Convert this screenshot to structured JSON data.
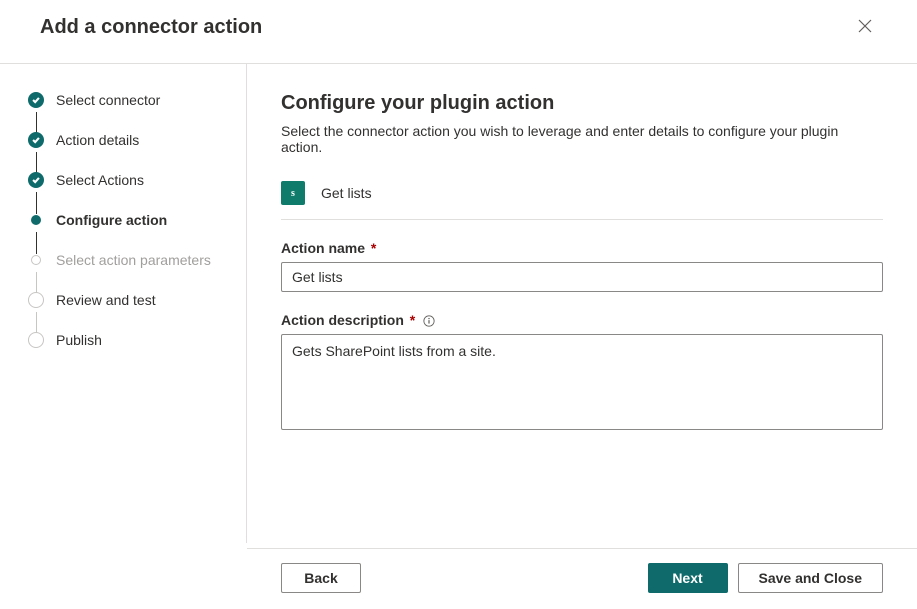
{
  "header": {
    "title": "Add a connector action"
  },
  "steps": [
    {
      "label": "Select connector",
      "state": "completed"
    },
    {
      "label": "Action details",
      "state": "completed"
    },
    {
      "label": "Select Actions",
      "state": "completed"
    },
    {
      "label": "Configure action",
      "state": "current"
    },
    {
      "label": "Select action parameters",
      "state": "pending"
    },
    {
      "label": "Review and test",
      "state": "upcoming"
    },
    {
      "label": "Publish",
      "state": "upcoming"
    }
  ],
  "main": {
    "title": "Configure your plugin action",
    "subtitle": "Select the connector action you wish to leverage and enter details to configure your plugin action.",
    "selected_icon_text": "s",
    "selected_action": "Get lists",
    "action_name_label": "Action name",
    "action_name_value": "Get lists",
    "action_desc_label": "Action description",
    "action_desc_value": "Gets SharePoint lists from a site."
  },
  "footer": {
    "back": "Back",
    "next": "Next",
    "save_close": "Save and Close"
  }
}
